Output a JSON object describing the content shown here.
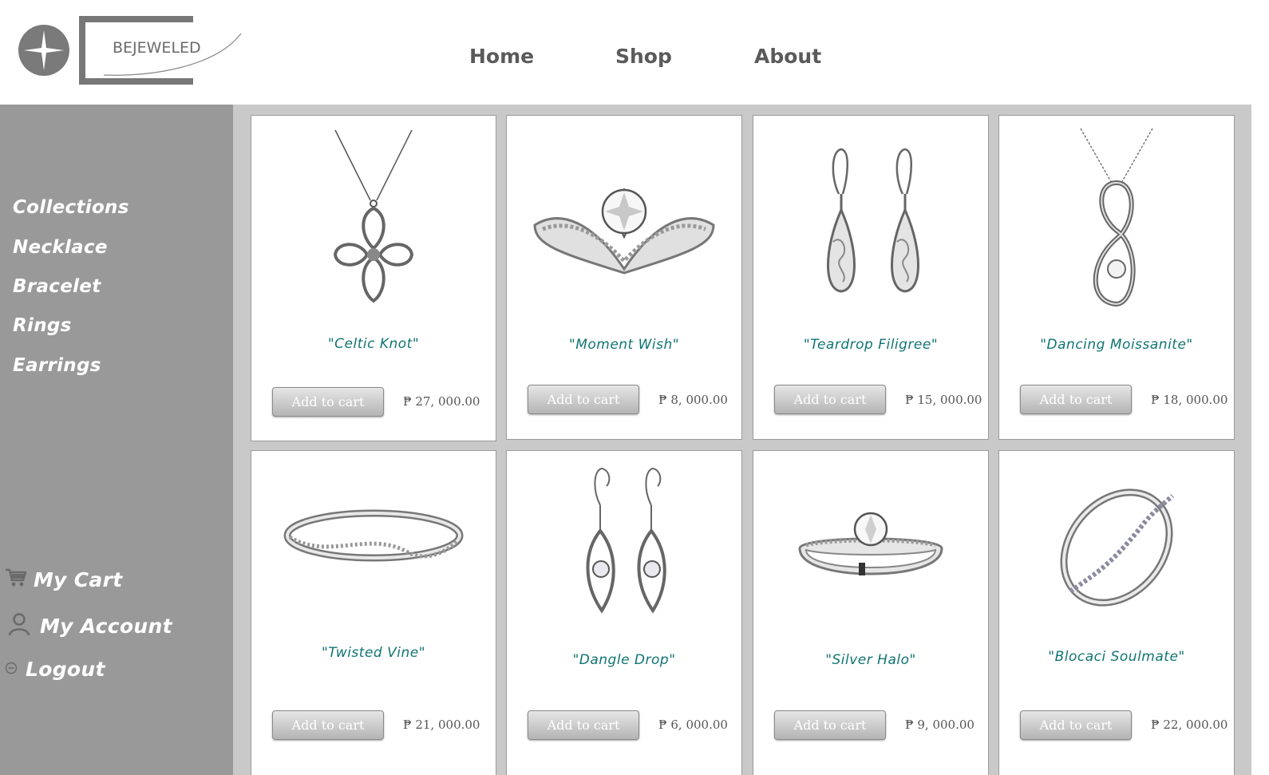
{
  "brand": {
    "logo_text": "BEJEWELED"
  },
  "nav": {
    "home": "Home",
    "shop": "Shop",
    "about": "About"
  },
  "sidebar": {
    "categories": [
      "Collections",
      "Necklace",
      "Bracelet",
      "Rings",
      "Earrings"
    ],
    "account": {
      "cart": "My Cart",
      "account": "My Account",
      "logout": "Logout"
    }
  },
  "products": [
    {
      "name": "\"Celtic Knot\"",
      "price": "₱ 27, 000.00",
      "button": "Add to cart",
      "icon": "celtic-cross-necklace-icon"
    },
    {
      "name": "\"Moment Wish\"",
      "price": "₱ 8, 000.00",
      "button": "Add to cart",
      "icon": "diamond-ring-icon"
    },
    {
      "name": "\"Teardrop Filigree\"",
      "price": "₱ 15, 000.00",
      "button": "Add to cart",
      "icon": "teardrop-earrings-icon"
    },
    {
      "name": "\"Dancing Moissanite\"",
      "price": "₱ 18, 000.00",
      "button": "Add to cart",
      "icon": "infinity-pendant-icon"
    },
    {
      "name": "\"Twisted Vine\"",
      "price": "₱ 21, 000.00",
      "button": "Add to cart",
      "icon": "twisted-band-ring-icon"
    },
    {
      "name": "\"Dangle Drop\"",
      "price": "₱ 6, 000.00",
      "button": "Add to cart",
      "icon": "dangle-earrings-icon"
    },
    {
      "name": "\"Silver Halo\"",
      "price": "₱ 9, 000.00",
      "button": "Add to cart",
      "icon": "solitaire-ring-icon"
    },
    {
      "name": "\"Blocaci Soulmate\"",
      "price": "₱ 22, 000.00",
      "button": "Add to cart",
      "icon": "twisted-diamond-ring-icon"
    }
  ],
  "colors": {
    "sidebar": "#999999",
    "grid_background": "#c9c9c9",
    "product_name": "#117474",
    "nav_text": "#5a5a5a"
  }
}
